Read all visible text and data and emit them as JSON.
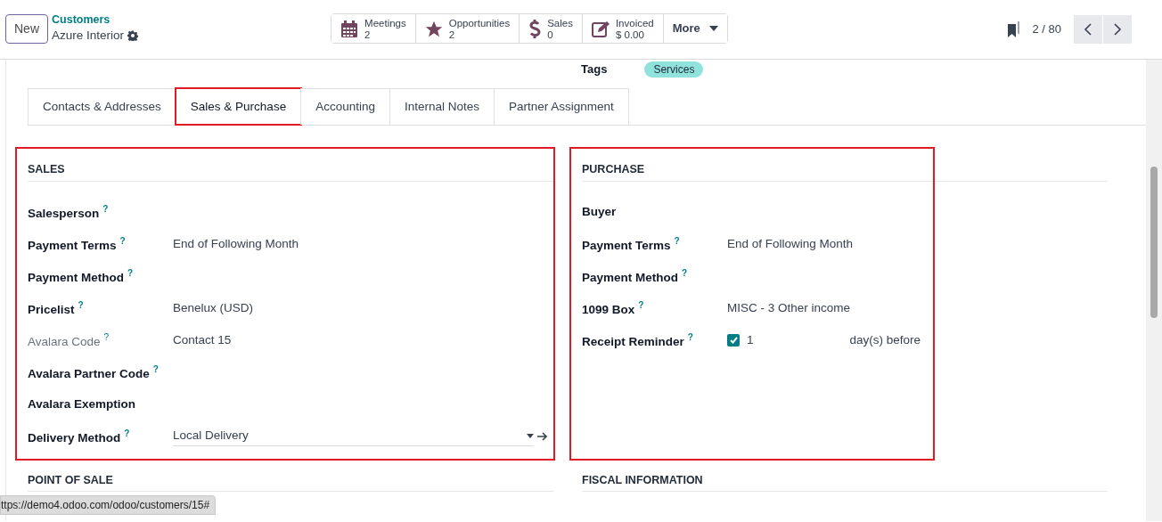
{
  "header": {
    "new_button": "New",
    "breadcrumb": "Customers",
    "record_title": "Azure Interior",
    "smart_buttons": [
      {
        "kind": "calendar",
        "label": "Meetings",
        "value": "2"
      },
      {
        "kind": "star",
        "label": "Opportunities",
        "value": "2"
      },
      {
        "kind": "dollar",
        "label": "Sales",
        "value": "0"
      },
      {
        "kind": "invoice",
        "label": "Invoiced",
        "value": "$ 0.00"
      }
    ],
    "more_button": "More",
    "pager": "2 / 80"
  },
  "tags": {
    "label": "Tags",
    "tag": "Services"
  },
  "tabs": [
    {
      "label": "Contacts & Addresses",
      "selected": false,
      "annotated": false
    },
    {
      "label": "Sales & Purchase",
      "selected": true,
      "annotated": true
    },
    {
      "label": "Accounting",
      "selected": false,
      "annotated": false
    },
    {
      "label": "Internal Notes",
      "selected": false,
      "annotated": false
    },
    {
      "label": "Partner Assignment",
      "selected": false,
      "annotated": false
    }
  ],
  "sections": [
    {
      "title": "SALES",
      "annotated": true,
      "fields": [
        {
          "kind": "text",
          "label": "Salesperson",
          "help": "?",
          "muted": false
        },
        {
          "kind": "text",
          "label": "Payment Terms",
          "help": "?",
          "muted": false,
          "value": "End of Following Month"
        },
        {
          "kind": "text",
          "label": "Payment Method",
          "help": "?",
          "muted": false
        },
        {
          "kind": "text",
          "label": "Pricelist",
          "help": "?",
          "muted": false,
          "value": "Benelux (USD)"
        },
        {
          "kind": "text",
          "label": "Avalara Code",
          "help": "?",
          "muted": true,
          "value": "Contact 15"
        },
        {
          "kind": "text",
          "label": "Avalara Partner Code",
          "help": "?",
          "muted": false
        },
        {
          "kind": "text",
          "label": "Avalara Exemption",
          "muted": false
        },
        {
          "kind": "select",
          "label": "Delivery Method",
          "help": "?",
          "muted": false,
          "value": "Local Delivery"
        }
      ]
    },
    {
      "title": "PURCHASE",
      "annotated": true,
      "fields": [
        {
          "kind": "text",
          "label": "Buyer",
          "muted": false
        },
        {
          "kind": "text",
          "label": "Payment Terms",
          "help": "?",
          "muted": false,
          "value": "End of Following Month"
        },
        {
          "kind": "text",
          "label": "Payment Method",
          "help": "?",
          "muted": false
        },
        {
          "kind": "text",
          "label": "1099 Box",
          "help": "?",
          "muted": false,
          "value": "MISC - 3 Other income"
        },
        {
          "kind": "reminder",
          "label": "Receipt Reminder",
          "help": "?",
          "muted": false,
          "checked": true,
          "value": "1",
          "suffix": "day(s) before"
        }
      ]
    }
  ],
  "lower_sections": [
    "POINT OF SALE",
    "FISCAL INFORMATION"
  ],
  "status_url": "ttps://demo4.odoo.com/odoo/customers/15#"
}
